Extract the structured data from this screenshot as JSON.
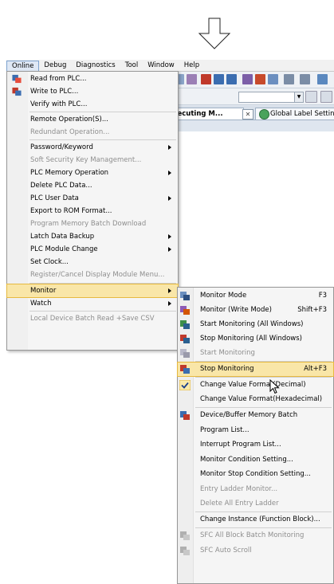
{
  "menubar": {
    "items": [
      {
        "label": "Online",
        "active": true
      },
      {
        "label": "Debug"
      },
      {
        "label": "Diagnostics"
      },
      {
        "label": "Tool"
      },
      {
        "label": "Window"
      },
      {
        "label": "Help"
      }
    ]
  },
  "tabs": {
    "active": "xecuting M...",
    "close": "✕",
    "other": "Global Label Setting Gl"
  },
  "online_menu": [
    {
      "label": "Read from PLC...",
      "icon": "read-from-plc-icon"
    },
    {
      "label": "Write to PLC...",
      "icon": "write-to-plc-icon"
    },
    {
      "label": "Verify with PLC..."
    },
    {
      "label": "Remote Operation(S)..."
    },
    {
      "label": "Redundant Operation...",
      "disabled": true
    },
    {
      "label": "Password/Keyword",
      "submenu": true
    },
    {
      "label": "Soft Security Key Management...",
      "disabled": true
    },
    {
      "label": "PLC Memory Operation",
      "submenu": true
    },
    {
      "label": "Delete PLC Data..."
    },
    {
      "label": "PLC User Data",
      "submenu": true
    },
    {
      "label": "Export to ROM Format..."
    },
    {
      "label": "Program Memory Batch Download",
      "disabled": true
    },
    {
      "label": "Latch Data Backup",
      "submenu": true
    },
    {
      "label": "PLC Module Change",
      "submenu": true
    },
    {
      "label": "Set Clock..."
    },
    {
      "label": "Register/Cancel Display Module Menu...",
      "disabled": true
    },
    {
      "label": "Monitor",
      "submenu": true,
      "highlighted": true
    },
    {
      "label": "Watch",
      "submenu": true
    },
    {
      "label": "Local Device Batch Read +Save CSV",
      "disabled": true
    }
  ],
  "monitor_menu": [
    {
      "label": "Monitor Mode",
      "shortcut": "F3",
      "icon": "monitor-mode-icon"
    },
    {
      "label": "Monitor (Write Mode)",
      "shortcut": "Shift+F3",
      "icon": "monitor-write-mode-icon"
    },
    {
      "label": "Start Monitoring (All Windows)",
      "icon": "start-monitoring-all-icon"
    },
    {
      "label": "Stop Monitoring (All Windows)",
      "icon": "stop-monitoring-all-icon"
    },
    {
      "label": "Start Monitoring",
      "disabled": true,
      "icon": "start-monitoring-icon"
    },
    {
      "label": "Stop Monitoring",
      "shortcut": "Alt+F3",
      "highlighted": true,
      "icon": "stop-monitoring-icon"
    },
    {
      "label": "Change Value Format(Decimal)",
      "checked": true,
      "icon": "checkmark-icon"
    },
    {
      "label": "Change Value Format(Hexadecimal)"
    },
    {
      "label": "Device/Buffer Memory Batch",
      "icon": "device-batch-icon"
    },
    {
      "label": "Program List..."
    },
    {
      "label": "Interrupt Program List..."
    },
    {
      "label": "Monitor Condition Setting..."
    },
    {
      "label": "Monitor Stop Condition Setting..."
    },
    {
      "label": "Entry Ladder Monitor...",
      "disabled": true
    },
    {
      "label": "Delete All Entry Ladder",
      "disabled": true
    },
    {
      "label": "Change Instance (Function Block)..."
    },
    {
      "label": "SFC All Block Batch Monitoring",
      "disabled": true,
      "icon": "sfc-batch-icon"
    },
    {
      "label": "SFC Auto Scroll",
      "disabled": true,
      "icon": "sfc-auto-scroll-icon"
    }
  ],
  "colors": {
    "highlight_bg": "#f9e6a8",
    "highlight_border": "#e6b940",
    "disabled_text": "#8e8e8e"
  }
}
